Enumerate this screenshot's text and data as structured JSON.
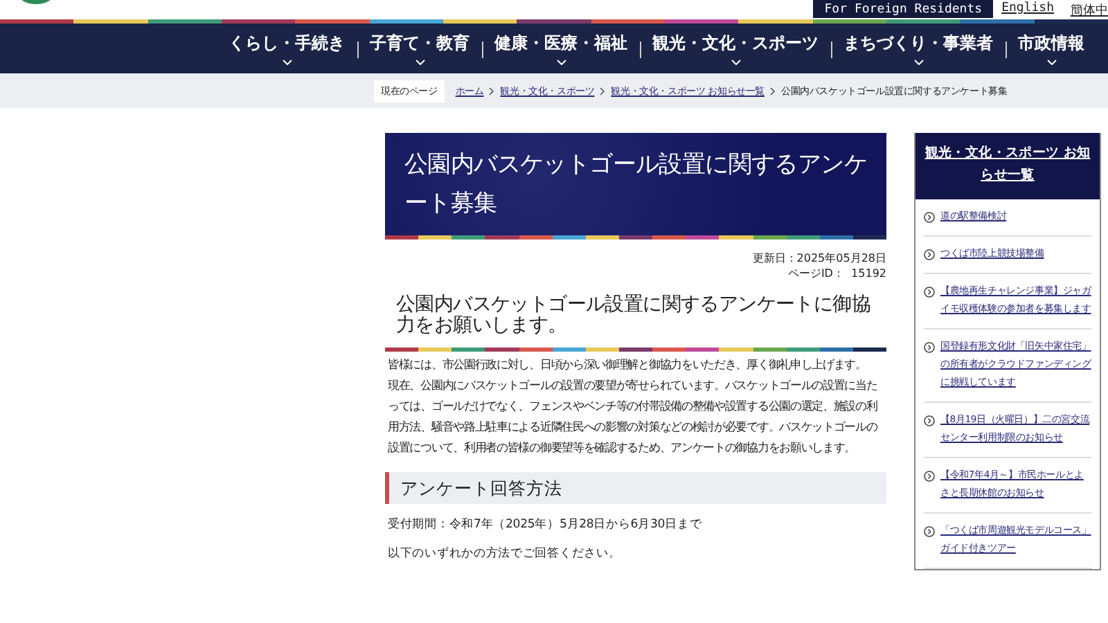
{
  "utility_links": {
    "foreign_residents": "For Foreign Residents",
    "english": "English",
    "chinese": "簡体中"
  },
  "nav": [
    "くらし・手続き",
    "子育て・教育",
    "健康・医療・福祉",
    "観光・文化・スポーツ",
    "まちづくり・事業者",
    "市政情報"
  ],
  "breadcrumb": {
    "label": "現在のページ",
    "links": [
      "ホーム",
      "観光・文化・スポーツ",
      "観光・文化・スポーツ お知らせ一覧"
    ],
    "current": "公園内バスケットゴール設置に関するアンケート募集"
  },
  "article": {
    "title": "公園内バスケットゴール設置に関するアンケート募集",
    "updated": "更新日：2025年05月28日",
    "page_id": "ページID：  15192",
    "heading": "公園内バスケットゴール設置に関するアンケートに御協力をお願いします。",
    "paragraphs": [
      "皆様には、市公園行政に対し、日頃から深い御理解と御協力をいただき、厚く御礼申し上げます。",
      "現在、公園内にバスケットゴールの設置の要望が寄せられています。バスケットゴールの設置に当たっては、ゴールだけでなく、フェンスやベンチ等の付帯設備の整備や設置する公園の選定、施設の利用方法、騒音や路上駐車による近隣住民への影響の対策などの検討が必要です。バスケットゴールの設置について、利用者の皆様の御要望等を確認するため、アンケートの御協力をお願いします。"
    ],
    "section": "アンケート回答方法",
    "section_lines": [
      "受付期間：令和7年（2025年）5月28日から6月30日まで",
      "以下のいずれかの方法でご回答ください。"
    ]
  },
  "sidebar": {
    "title": "観光・文化・スポーツ お知らせ一覧",
    "items": [
      "道の駅整備検討",
      "つくば市陸上競技場整備",
      "【農地再生チャレンジ事業】ジャガイモ収穫体験の参加者を募集します",
      "国登録有形文化財「旧矢中家住宅」の所有者がクラウドファンディングに挑戦しています",
      "【8月19日（火曜日）】二の宮交流センター利用制限のお知らせ",
      "【令和7年4月～】市民ホールとよさと長期休館のお知らせ",
      "「つくば市周遊観光モデルコース」ガイド付きツアー"
    ]
  }
}
